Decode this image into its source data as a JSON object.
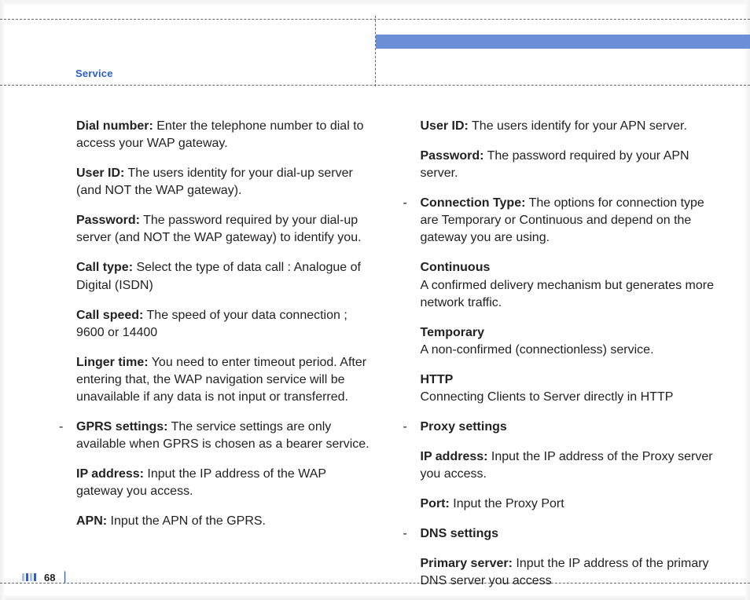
{
  "header": {
    "section_label": "Service"
  },
  "footer": {
    "page_number": "68"
  },
  "left_column": {
    "dial_number_label": "Dial number:",
    "dial_number_text": " Enter the telephone number to dial to access your WAP gateway.",
    "user_id_label": "User ID:",
    "user_id_text": " The users identity for your dial-up server (and NOT the WAP gateway).",
    "password_label": "Password:",
    "password_text": " The password required by your dial-up server (and NOT the WAP gateway) to identify you.",
    "call_type_label": "Call type:",
    "call_type_text": " Select the type of data call : Analogue of Digital (ISDN)",
    "call_speed_label": "Call speed:",
    "call_speed_text": " The speed of your data connection ; 9600 or 14400",
    "linger_label": "Linger time:",
    "linger_text": " You need to enter timeout period. After entering that, the WAP navigation service will be unavailable if any data is not input or transferred.",
    "gprs_label": "GPRS settings:",
    "gprs_text": " The service settings are only available when GPRS is chosen as a bearer service.",
    "ip_label": "IP address:",
    "ip_text": " Input the IP address of the WAP gateway you access.",
    "apn_label": "APN:",
    "apn_text": " Input the APN of the GPRS."
  },
  "right_column": {
    "user_id_label": "User ID:",
    "user_id_text": " The users identify for your APN server.",
    "password_label": "Password:",
    "password_text": " The password required by your APN server.",
    "conn_type_label": "Connection Type:",
    "conn_type_text": " The options for connection type are Temporary or Continuous and depend on the gateway you are using.",
    "continuous_label": "Continuous",
    "continuous_text": "A confirmed delivery mechanism but generates more network traffic.",
    "temporary_label": "Temporary",
    "temporary_text": "A non-confirmed (connectionless) service.",
    "http_label": "HTTP",
    "http_text": "Connecting Clients to Server directly in HTTP",
    "proxy_label": "Proxy settings",
    "proxy_ip_label": "IP address:",
    "proxy_ip_text": " Input the IP address of the Proxy server you access.",
    "proxy_port_label": "Port:",
    "proxy_port_text": " Input the Proxy Port",
    "dns_label": "DNS settings",
    "dns_primary_label": "Primary server:",
    "dns_primary_text": " Input the IP address of the primary DNS server you access"
  }
}
